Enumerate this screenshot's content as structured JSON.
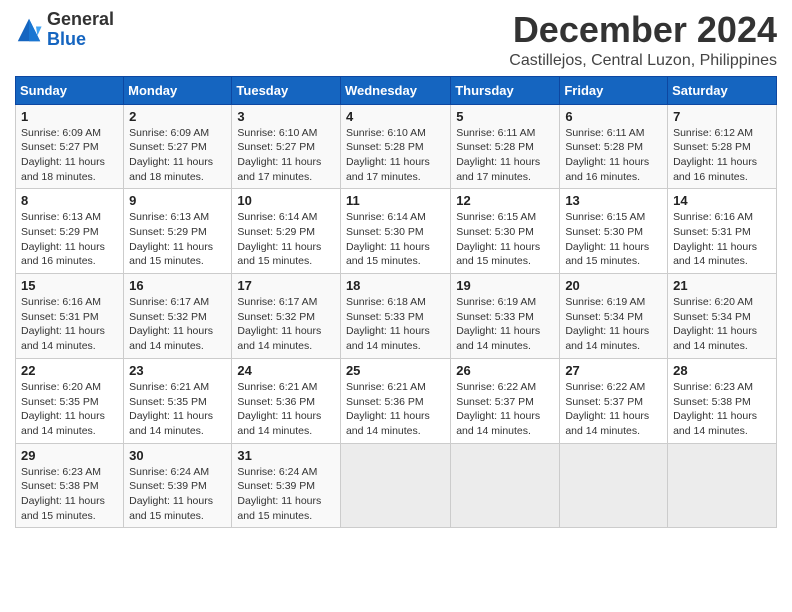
{
  "header": {
    "logo_line1": "General",
    "logo_line2": "Blue",
    "title": "December 2024",
    "subtitle": "Castillejos, Central Luzon, Philippines"
  },
  "weekdays": [
    "Sunday",
    "Monday",
    "Tuesday",
    "Wednesday",
    "Thursday",
    "Friday",
    "Saturday"
  ],
  "weeks": [
    [
      {
        "day": "1",
        "info": "Sunrise: 6:09 AM\nSunset: 5:27 PM\nDaylight: 11 hours\nand 18 minutes."
      },
      {
        "day": "2",
        "info": "Sunrise: 6:09 AM\nSunset: 5:27 PM\nDaylight: 11 hours\nand 18 minutes."
      },
      {
        "day": "3",
        "info": "Sunrise: 6:10 AM\nSunset: 5:27 PM\nDaylight: 11 hours\nand 17 minutes."
      },
      {
        "day": "4",
        "info": "Sunrise: 6:10 AM\nSunset: 5:28 PM\nDaylight: 11 hours\nand 17 minutes."
      },
      {
        "day": "5",
        "info": "Sunrise: 6:11 AM\nSunset: 5:28 PM\nDaylight: 11 hours\nand 17 minutes."
      },
      {
        "day": "6",
        "info": "Sunrise: 6:11 AM\nSunset: 5:28 PM\nDaylight: 11 hours\nand 16 minutes."
      },
      {
        "day": "7",
        "info": "Sunrise: 6:12 AM\nSunset: 5:28 PM\nDaylight: 11 hours\nand 16 minutes."
      }
    ],
    [
      {
        "day": "8",
        "info": "Sunrise: 6:13 AM\nSunset: 5:29 PM\nDaylight: 11 hours\nand 16 minutes."
      },
      {
        "day": "9",
        "info": "Sunrise: 6:13 AM\nSunset: 5:29 PM\nDaylight: 11 hours\nand 15 minutes."
      },
      {
        "day": "10",
        "info": "Sunrise: 6:14 AM\nSunset: 5:29 PM\nDaylight: 11 hours\nand 15 minutes."
      },
      {
        "day": "11",
        "info": "Sunrise: 6:14 AM\nSunset: 5:30 PM\nDaylight: 11 hours\nand 15 minutes."
      },
      {
        "day": "12",
        "info": "Sunrise: 6:15 AM\nSunset: 5:30 PM\nDaylight: 11 hours\nand 15 minutes."
      },
      {
        "day": "13",
        "info": "Sunrise: 6:15 AM\nSunset: 5:30 PM\nDaylight: 11 hours\nand 15 minutes."
      },
      {
        "day": "14",
        "info": "Sunrise: 6:16 AM\nSunset: 5:31 PM\nDaylight: 11 hours\nand 14 minutes."
      }
    ],
    [
      {
        "day": "15",
        "info": "Sunrise: 6:16 AM\nSunset: 5:31 PM\nDaylight: 11 hours\nand 14 minutes."
      },
      {
        "day": "16",
        "info": "Sunrise: 6:17 AM\nSunset: 5:32 PM\nDaylight: 11 hours\nand 14 minutes."
      },
      {
        "day": "17",
        "info": "Sunrise: 6:17 AM\nSunset: 5:32 PM\nDaylight: 11 hours\nand 14 minutes."
      },
      {
        "day": "18",
        "info": "Sunrise: 6:18 AM\nSunset: 5:33 PM\nDaylight: 11 hours\nand 14 minutes."
      },
      {
        "day": "19",
        "info": "Sunrise: 6:19 AM\nSunset: 5:33 PM\nDaylight: 11 hours\nand 14 minutes."
      },
      {
        "day": "20",
        "info": "Sunrise: 6:19 AM\nSunset: 5:34 PM\nDaylight: 11 hours\nand 14 minutes."
      },
      {
        "day": "21",
        "info": "Sunrise: 6:20 AM\nSunset: 5:34 PM\nDaylight: 11 hours\nand 14 minutes."
      }
    ],
    [
      {
        "day": "22",
        "info": "Sunrise: 6:20 AM\nSunset: 5:35 PM\nDaylight: 11 hours\nand 14 minutes."
      },
      {
        "day": "23",
        "info": "Sunrise: 6:21 AM\nSunset: 5:35 PM\nDaylight: 11 hours\nand 14 minutes."
      },
      {
        "day": "24",
        "info": "Sunrise: 6:21 AM\nSunset: 5:36 PM\nDaylight: 11 hours\nand 14 minutes."
      },
      {
        "day": "25",
        "info": "Sunrise: 6:21 AM\nSunset: 5:36 PM\nDaylight: 11 hours\nand 14 minutes."
      },
      {
        "day": "26",
        "info": "Sunrise: 6:22 AM\nSunset: 5:37 PM\nDaylight: 11 hours\nand 14 minutes."
      },
      {
        "day": "27",
        "info": "Sunrise: 6:22 AM\nSunset: 5:37 PM\nDaylight: 11 hours\nand 14 minutes."
      },
      {
        "day": "28",
        "info": "Sunrise: 6:23 AM\nSunset: 5:38 PM\nDaylight: 11 hours\nand 14 minutes."
      }
    ],
    [
      {
        "day": "29",
        "info": "Sunrise: 6:23 AM\nSunset: 5:38 PM\nDaylight: 11 hours\nand 15 minutes."
      },
      {
        "day": "30",
        "info": "Sunrise: 6:24 AM\nSunset: 5:39 PM\nDaylight: 11 hours\nand 15 minutes."
      },
      {
        "day": "31",
        "info": "Sunrise: 6:24 AM\nSunset: 5:39 PM\nDaylight: 11 hours\nand 15 minutes."
      },
      {
        "day": "",
        "info": ""
      },
      {
        "day": "",
        "info": ""
      },
      {
        "day": "",
        "info": ""
      },
      {
        "day": "",
        "info": ""
      }
    ]
  ]
}
